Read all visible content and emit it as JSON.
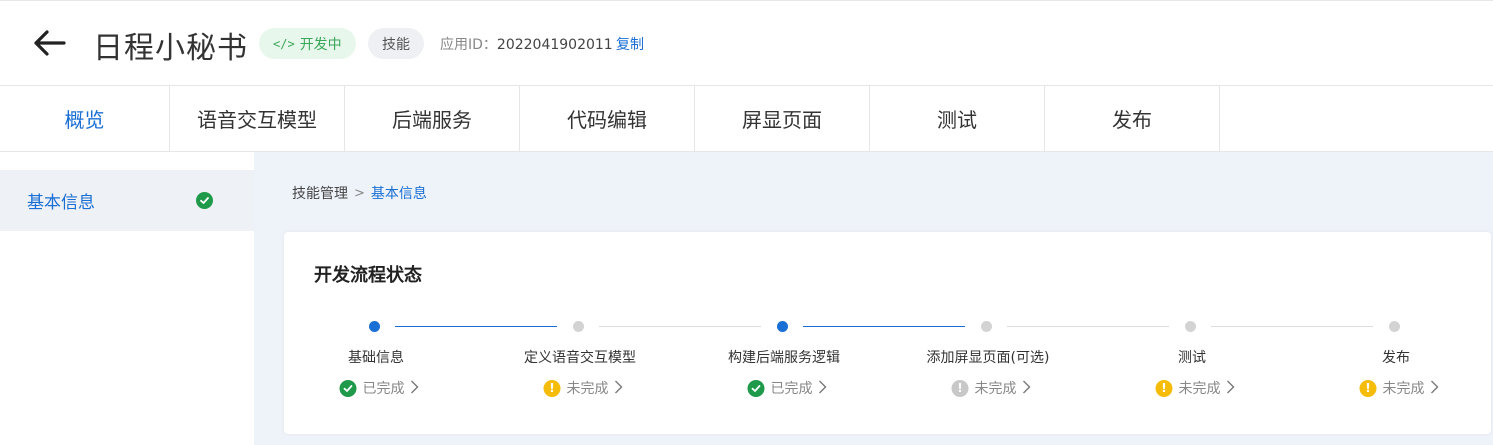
{
  "header": {
    "title": "日程小秘书",
    "dev_tag": "开发中",
    "skill_tag": "技能",
    "app_id_label": "应用ID：",
    "app_id_value": "2022041902011",
    "copy_label": "复制"
  },
  "tabs": [
    {
      "label": "概览",
      "active": true
    },
    {
      "label": "语音交互模型",
      "active": false
    },
    {
      "label": "后端服务",
      "active": false
    },
    {
      "label": "代码编辑",
      "active": false
    },
    {
      "label": "屏显页面",
      "active": false
    },
    {
      "label": "测试",
      "active": false
    },
    {
      "label": "发布",
      "active": false
    }
  ],
  "sidebar": {
    "items": [
      {
        "label": "基本信息",
        "status": "done"
      }
    ]
  },
  "breadcrumb": {
    "root": "技能管理",
    "separator": ">",
    "current": "基本信息"
  },
  "card": {
    "title": "开发流程状态",
    "steps": [
      {
        "name": "基础信息",
        "status_text": "已完成",
        "status": "done",
        "dot": "blue"
      },
      {
        "name": "定义语音交互模型",
        "status_text": "未完成",
        "status": "warn",
        "dot": "grey"
      },
      {
        "name": "构建后端服务逻辑",
        "status_text": "已完成",
        "status": "done",
        "dot": "blue"
      },
      {
        "name": "添加屏显页面(可选)",
        "status_text": "未完成",
        "status": "gray",
        "dot": "grey"
      },
      {
        "name": "测试",
        "status_text": "未完成",
        "status": "warn",
        "dot": "grey"
      },
      {
        "name": "发布",
        "status_text": "未完成",
        "status": "warn",
        "dot": "grey"
      }
    ]
  },
  "colors": {
    "accent": "#1a6fd4",
    "success": "#1f9a4a",
    "warning": "#f5bd0a",
    "neutral": "#c8c8c8"
  }
}
